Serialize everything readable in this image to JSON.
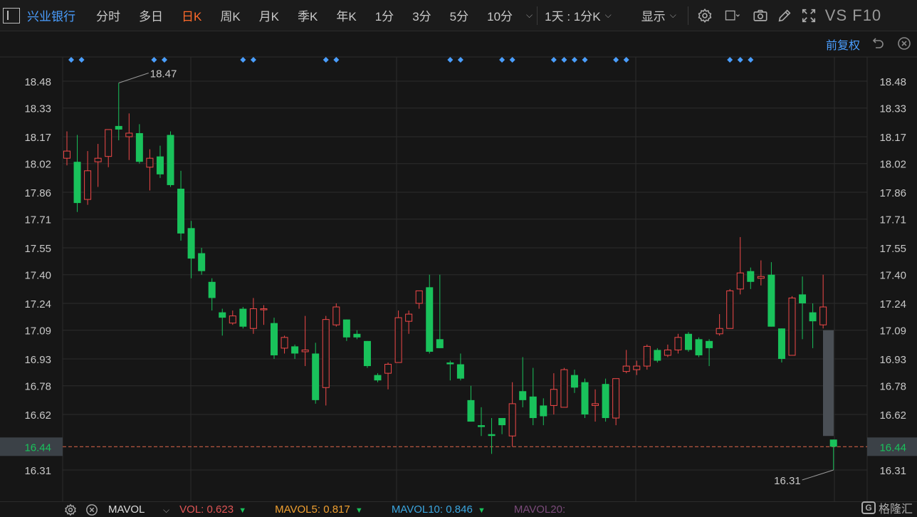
{
  "toolbar": {
    "stock_name": "兴业银行",
    "periods": [
      {
        "label": "分时",
        "active": false
      },
      {
        "label": "多日",
        "active": false
      },
      {
        "label": "日K",
        "active": true
      },
      {
        "label": "周K",
        "active": false
      },
      {
        "label": "月K",
        "active": false
      },
      {
        "label": "季K",
        "active": false
      },
      {
        "label": "年K",
        "active": false
      },
      {
        "label": "1分",
        "active": false
      },
      {
        "label": "3分",
        "active": false
      },
      {
        "label": "5分",
        "active": false
      },
      {
        "label": "10分",
        "active": false
      }
    ],
    "range_label": "1天 : 1分K",
    "display_label": "显示",
    "vs_f10_label": "VS F10"
  },
  "adjust_label": "前复权",
  "colors": {
    "up": "#f04848",
    "down": "#19c25b",
    "accent": "#4a9eff",
    "active": "#ff6a2a",
    "grid": "#2c2c2c",
    "price_line": "#e0664a"
  },
  "chart_data": {
    "type": "candlestick",
    "ylim": [
      16.22,
      18.6
    ],
    "y_ticks": [
      "18.48",
      "18.33",
      "18.17",
      "18.02",
      "17.86",
      "17.71",
      "17.55",
      "17.40",
      "17.24",
      "17.09",
      "16.93",
      "16.78",
      "16.62",
      "16.44",
      "16.31"
    ],
    "current_price": "16.44",
    "high_label": "18.47",
    "low_label": "16.31",
    "volume_bar": {
      "top": 17.09,
      "bottom": 16.5
    },
    "marker_groups": [
      [
        0,
        1
      ],
      [
        8,
        9
      ],
      [
        17,
        18
      ],
      [
        25,
        26
      ],
      [
        37,
        38
      ],
      [
        42,
        43
      ],
      [
        47,
        48,
        49,
        50
      ],
      [
        53,
        54
      ],
      [
        64,
        65,
        66
      ]
    ],
    "candles": [
      {
        "o": 18.05,
        "c": 18.09,
        "h": 18.2,
        "l": 18.01
      },
      {
        "o": 18.03,
        "c": 17.8,
        "h": 18.18,
        "l": 17.75
      },
      {
        "o": 17.82,
        "c": 17.98,
        "h": 18.09,
        "l": 17.79
      },
      {
        "o": 18.03,
        "c": 18.05,
        "h": 18.13,
        "l": 17.89
      },
      {
        "o": 18.06,
        "c": 18.21,
        "h": 18.21,
        "l": 18.0
      },
      {
        "o": 18.23,
        "c": 18.21,
        "h": 18.47,
        "l": 18.15
      },
      {
        "o": 18.17,
        "c": 18.19,
        "h": 18.3,
        "l": 18.04
      },
      {
        "o": 18.19,
        "c": 18.03,
        "h": 18.24,
        "l": 18.02
      },
      {
        "o": 18.0,
        "c": 18.05,
        "h": 18.1,
        "l": 17.87
      },
      {
        "o": 18.06,
        "c": 17.96,
        "h": 18.12,
        "l": 17.94
      },
      {
        "o": 18.18,
        "c": 17.9,
        "h": 18.2,
        "l": 17.89
      },
      {
        "o": 17.88,
        "c": 17.63,
        "h": 17.98,
        "l": 17.59
      },
      {
        "o": 17.66,
        "c": 17.49,
        "h": 17.7,
        "l": 17.38
      },
      {
        "o": 17.52,
        "c": 17.42,
        "h": 17.55,
        "l": 17.4
      },
      {
        "o": 17.36,
        "c": 17.27,
        "h": 17.38,
        "l": 17.2
      },
      {
        "o": 17.19,
        "c": 17.16,
        "h": 17.21,
        "l": 17.06
      },
      {
        "o": 17.13,
        "c": 17.17,
        "h": 17.2,
        "l": 17.12
      },
      {
        "o": 17.21,
        "c": 17.11,
        "h": 17.22,
        "l": 17.1
      },
      {
        "o": 17.1,
        "c": 17.21,
        "h": 17.27,
        "l": 17.07
      },
      {
        "o": 17.21,
        "c": 17.21,
        "h": 17.23,
        "l": 17.12
      },
      {
        "o": 17.13,
        "c": 16.95,
        "h": 17.16,
        "l": 16.93
      },
      {
        "o": 16.99,
        "c": 17.05,
        "h": 17.06,
        "l": 16.96
      },
      {
        "o": 17.0,
        "c": 16.96,
        "h": 17.01,
        "l": 16.93
      },
      {
        "o": 16.97,
        "c": 16.98,
        "h": 17.17,
        "l": 16.89
      },
      {
        "o": 16.96,
        "c": 16.7,
        "h": 17.02,
        "l": 16.68
      },
      {
        "o": 16.77,
        "c": 17.15,
        "h": 17.17,
        "l": 16.67
      },
      {
        "o": 17.12,
        "c": 17.22,
        "h": 17.24,
        "l": 17.11
      },
      {
        "o": 17.15,
        "c": 17.05,
        "h": 17.15,
        "l": 17.03
      },
      {
        "o": 17.07,
        "c": 17.05,
        "h": 17.09,
        "l": 17.04
      },
      {
        "o": 17.03,
        "c": 16.89,
        "h": 17.03,
        "l": 16.88
      },
      {
        "o": 16.84,
        "c": 16.81,
        "h": 16.85,
        "l": 16.8
      },
      {
        "o": 16.85,
        "c": 16.9,
        "h": 16.91,
        "l": 16.76
      },
      {
        "o": 16.91,
        "c": 17.16,
        "h": 17.2,
        "l": 16.91
      },
      {
        "o": 17.14,
        "c": 17.18,
        "h": 17.2,
        "l": 17.07
      },
      {
        "o": 17.24,
        "c": 17.31,
        "h": 17.31,
        "l": 17.21
      },
      {
        "o": 17.33,
        "c": 16.97,
        "h": 17.4,
        "l": 16.96
      },
      {
        "o": 17.04,
        "c": 16.99,
        "h": 17.4,
        "l": 16.99
      },
      {
        "o": 16.91,
        "c": 16.9,
        "h": 16.92,
        "l": 16.81
      },
      {
        "o": 16.9,
        "c": 16.82,
        "h": 16.96,
        "l": 16.81
      },
      {
        "o": 16.7,
        "c": 16.58,
        "h": 16.78,
        "l": 16.58
      },
      {
        "o": 16.56,
        "c": 16.55,
        "h": 16.66,
        "l": 16.5
      },
      {
        "o": 16.51,
        "c": 16.5,
        "h": 16.6,
        "l": 16.4
      },
      {
        "o": 16.6,
        "c": 16.56,
        "h": 16.6,
        "l": 16.51
      },
      {
        "o": 16.5,
        "c": 16.68,
        "h": 16.8,
        "l": 16.44
      },
      {
        "o": 16.75,
        "c": 16.7,
        "h": 16.94,
        "l": 16.66
      },
      {
        "o": 16.72,
        "c": 16.6,
        "h": 16.88,
        "l": 16.56
      },
      {
        "o": 16.67,
        "c": 16.61,
        "h": 16.71,
        "l": 16.56
      },
      {
        "o": 16.67,
        "c": 16.76,
        "h": 16.85,
        "l": 16.62
      },
      {
        "o": 16.66,
        "c": 16.87,
        "h": 16.88,
        "l": 16.66
      },
      {
        "o": 16.84,
        "c": 16.77,
        "h": 16.87,
        "l": 16.74
      },
      {
        "o": 16.8,
        "c": 16.62,
        "h": 16.82,
        "l": 16.6
      },
      {
        "o": 16.67,
        "c": 16.68,
        "h": 16.76,
        "l": 16.58
      },
      {
        "o": 16.79,
        "c": 16.6,
        "h": 16.82,
        "l": 16.58
      },
      {
        "o": 16.6,
        "c": 16.82,
        "h": 16.82,
        "l": 16.56
      },
      {
        "o": 16.86,
        "c": 16.89,
        "h": 16.98,
        "l": 16.85
      },
      {
        "o": 16.87,
        "c": 16.89,
        "h": 16.92,
        "l": 16.84
      },
      {
        "o": 16.89,
        "c": 17.0,
        "h": 17.01,
        "l": 16.87
      },
      {
        "o": 16.98,
        "c": 16.92,
        "h": 16.99,
        "l": 16.91
      },
      {
        "o": 16.95,
        "c": 16.98,
        "h": 17.01,
        "l": 16.94
      },
      {
        "o": 16.98,
        "c": 17.05,
        "h": 17.07,
        "l": 16.96
      },
      {
        "o": 17.07,
        "c": 16.98,
        "h": 17.08,
        "l": 16.97
      },
      {
        "o": 17.04,
        "c": 16.95,
        "h": 17.05,
        "l": 16.94
      },
      {
        "o": 17.03,
        "c": 16.99,
        "h": 17.04,
        "l": 16.89
      },
      {
        "o": 17.07,
        "c": 17.1,
        "h": 17.18,
        "l": 17.06
      },
      {
        "o": 17.1,
        "c": 17.31,
        "h": 17.32,
        "l": 17.1
      },
      {
        "o": 17.32,
        "c": 17.41,
        "h": 17.61,
        "l": 17.29
      },
      {
        "o": 17.42,
        "c": 17.36,
        "h": 17.44,
        "l": 17.32
      },
      {
        "o": 17.38,
        "c": 17.39,
        "h": 17.48,
        "l": 17.34
      },
      {
        "o": 17.4,
        "c": 17.11,
        "h": 17.47,
        "l": 17.11
      },
      {
        "o": 17.1,
        "c": 16.93,
        "h": 17.1,
        "l": 16.91
      },
      {
        "o": 16.95,
        "c": 17.27,
        "h": 17.28,
        "l": 16.95
      },
      {
        "o": 17.29,
        "c": 17.24,
        "h": 17.39,
        "l": 17.04
      },
      {
        "o": 17.19,
        "c": 17.14,
        "h": 17.24,
        "l": 16.99
      },
      {
        "o": 17.12,
        "c": 17.22,
        "h": 17.4,
        "l": 17.1
      },
      {
        "o": 16.48,
        "c": 16.44,
        "h": 16.48,
        "l": 16.31
      }
    ]
  },
  "bottom_bar": {
    "indicator": "MAVOL",
    "vol_label": "VOL:",
    "vol_value": "0.623",
    "mavol5_label": "MAVOL5:",
    "mavol5_value": "0.817",
    "mavol10_label": "MAVOL10:",
    "mavol10_value": "0.846",
    "mavol20_label": "MAVOL20:"
  },
  "watermark": "格隆汇"
}
